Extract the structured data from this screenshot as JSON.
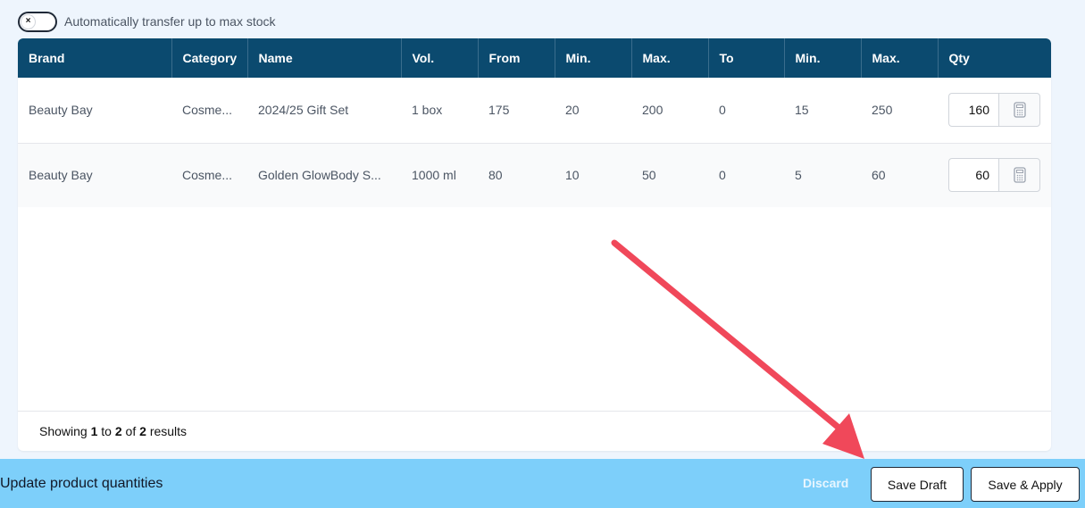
{
  "toggle": {
    "label": "Automatically transfer up to max stock",
    "knob_glyph": "×",
    "checked": false
  },
  "table": {
    "columns": [
      "Brand",
      "Category",
      "Name",
      "Vol.",
      "From",
      "Min.",
      "Max.",
      "To",
      "Min.",
      "Max.",
      "Qty"
    ],
    "rows": [
      {
        "brand": "Beauty Bay",
        "category": "Cosme...",
        "name": "2024/25 Gift Set",
        "vol": "1 box",
        "from": "175",
        "from_min": "20",
        "from_max": "200",
        "to": "0",
        "to_min": "15",
        "to_max": "250",
        "qty": "160"
      },
      {
        "brand": "Beauty Bay",
        "category": "Cosme...",
        "name": "Golden GlowBody S...",
        "vol": "1000 ml",
        "from": "80",
        "from_min": "10",
        "from_max": "50",
        "to": "0",
        "to_min": "5",
        "to_max": "60",
        "qty": "60"
      }
    ],
    "qty_button_icon": "calculator-icon"
  },
  "pagination": {
    "prefix": "Showing",
    "start": "1",
    "to_word": "to",
    "end": "2",
    "of_word": "of",
    "total": "2",
    "suffix": "results"
  },
  "bottom_bar": {
    "title": "Update product quantities",
    "discard_label": "Discard",
    "save_draft_label": "Save Draft",
    "save_apply_label": "Save & Apply"
  },
  "colors": {
    "header_bg": "#0b4a6f",
    "bottom_bar_bg": "#7dcffa",
    "page_bg": "#eef5fd",
    "annotation_arrow": "#f0485a"
  }
}
